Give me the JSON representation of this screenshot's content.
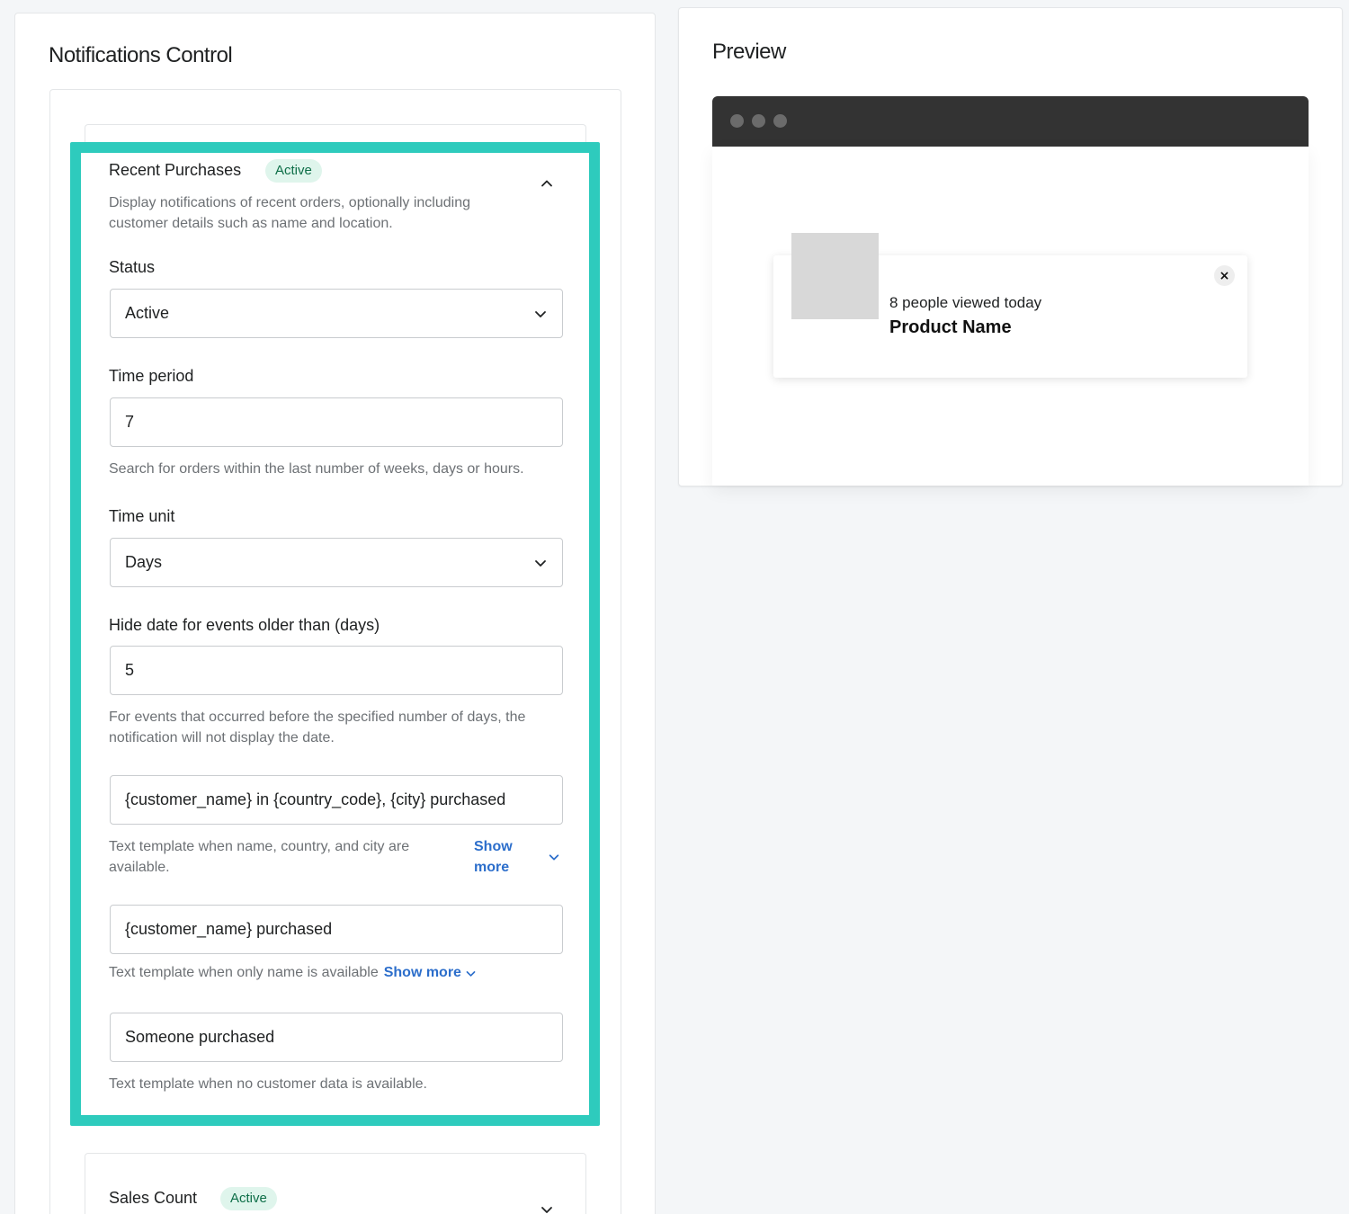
{
  "left_panel": {
    "title": "Notifications Control"
  },
  "recent_purchases": {
    "title": "Recent Purchases",
    "badge": "Active",
    "description": "Display notifications of recent orders, optionally including customer details such as name and location.",
    "status": {
      "label": "Status",
      "value": "Active"
    },
    "time_period": {
      "label": "Time period",
      "value": "7",
      "help": "Search for orders within the last number of weeks, days or hours."
    },
    "time_unit": {
      "label": "Time unit",
      "value": "Days"
    },
    "hide_date": {
      "label": "Hide date for events older than (days)",
      "value": "5",
      "help": "For events that occurred before the specified number of days, the notification will not display the date."
    },
    "template_full": {
      "value": "{customer_name} in {country_code}, {city} purchased",
      "help": "Text template when name, country, and city are available.",
      "link": "Show more"
    },
    "template_name": {
      "value": "{customer_name} purchased",
      "help": "Text template when only name is available",
      "link": "Show more"
    },
    "template_none": {
      "value": "Someone purchased",
      "help": "Text template when no customer data is available."
    }
  },
  "sales_count": {
    "title": "Sales Count",
    "badge": "Active"
  },
  "preview": {
    "title": "Preview",
    "popup_line1": "8 people viewed today",
    "popup_line2": "Product Name",
    "close_glyph": "×"
  },
  "colors": {
    "highlight": "#2ecbbd",
    "badge_bg": "#dff5ec",
    "badge_text": "#0d6e47",
    "link": "#2c6ecb",
    "browser_bar": "#333333"
  },
  "icons": [
    "chevron-up-icon",
    "chevron-down-icon",
    "close-icon",
    "window-dot-icon"
  ]
}
